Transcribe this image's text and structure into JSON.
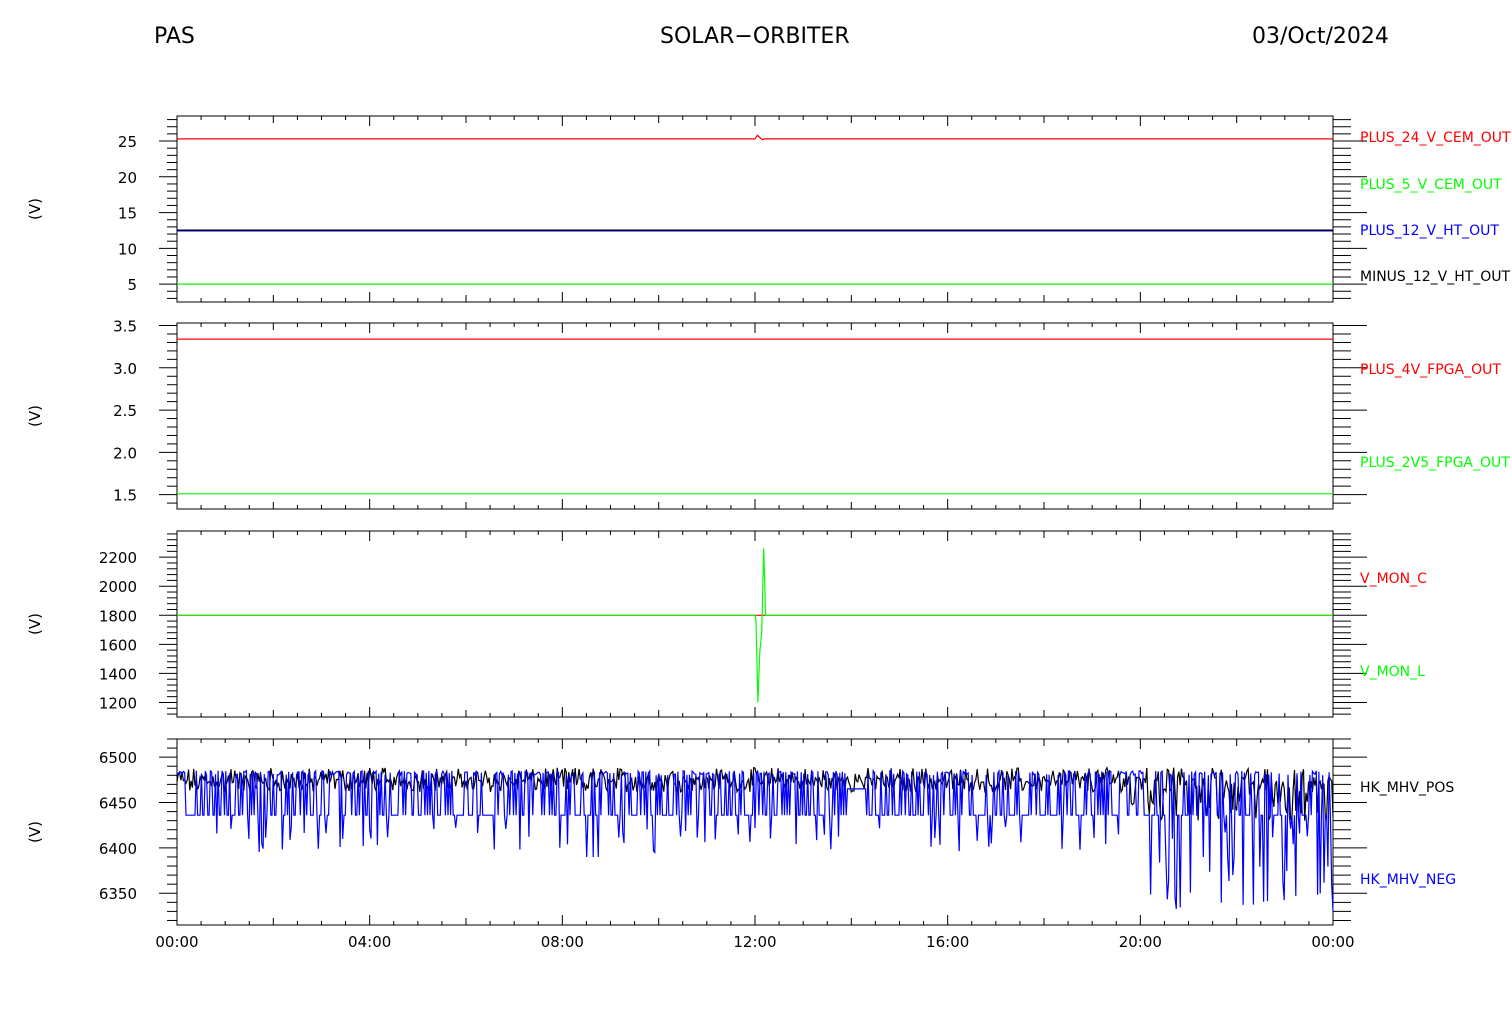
{
  "header": {
    "left": "PAS",
    "center": "SOLAR−ORBITER",
    "right": "03/Oct/2024"
  },
  "colors": {
    "red": "#ff0000",
    "green": "#00ff00",
    "blue": "#0000ff",
    "navy": "#00007f",
    "black": "#000000"
  },
  "chart_data": [
    {
      "type": "line",
      "ylabel": "(V)",
      "ylim": [
        2.5,
        28.5
      ],
      "yticks": [
        5,
        10,
        15,
        20,
        25
      ],
      "yticklabels": [
        "5",
        "10",
        "15",
        "20",
        "25"
      ],
      "xlim": [
        0,
        24
      ],
      "legend": "right",
      "series": [
        {
          "name": "PLUS_24_V_CEM_OUT",
          "color": "#ff0000",
          "x": [
            0,
            12.0,
            12.05,
            12.1,
            12.15,
            12.2,
            24
          ],
          "y": [
            25.3,
            25.3,
            25.8,
            25.5,
            25.2,
            25.3,
            25.3
          ]
        },
        {
          "name": "PLUS_5_V_CEM_OUT",
          "color": "#00ff00",
          "x": [
            0,
            24
          ],
          "y": [
            5.0,
            5.0
          ]
        },
        {
          "name": "PLUS_12_V_HT_OUT",
          "color": "#0000ff",
          "x": [
            0,
            24
          ],
          "y": [
            12.5,
            12.5
          ]
        },
        {
          "name": "MINUS_12_V_HT_OUT",
          "color": "#000000",
          "x": [
            0,
            24
          ],
          "y": [
            12.55,
            12.55
          ]
        }
      ]
    },
    {
      "type": "line",
      "ylabel": "(V)",
      "ylim": [
        1.33,
        3.53
      ],
      "yticks": [
        1.5,
        2.0,
        2.5,
        3.0,
        3.5
      ],
      "yticklabels": [
        "1.5",
        "2.0",
        "2.5",
        "3.0",
        "3.5"
      ],
      "xlim": [
        0,
        24
      ],
      "legend": "right",
      "series": [
        {
          "name": "PLUS_4V_FPGA_OUT",
          "color": "#ff0000",
          "x": [
            0,
            24
          ],
          "y": [
            3.34,
            3.34
          ]
        },
        {
          "name": "PLUS_2V5_FPGA_OUT",
          "color": "#00ff00",
          "x": [
            0,
            24
          ],
          "y": [
            1.51,
            1.51
          ]
        }
      ]
    },
    {
      "type": "line",
      "ylabel": "(V)",
      "ylim": [
        1100,
        2380
      ],
      "yticks": [
        1200,
        1400,
        1600,
        1800,
        2000,
        2200
      ],
      "yticklabels": [
        "1200",
        "1400",
        "1600",
        "1800",
        "2000",
        "2200"
      ],
      "xlim": [
        0,
        24
      ],
      "legend": "right",
      "series": [
        {
          "name": "V_MON_C",
          "color": "#ff0000",
          "x": [
            0,
            24
          ],
          "y": [
            1800,
            1800
          ]
        },
        {
          "name": "V_MON_L",
          "color": "#00ff00",
          "x": [
            0,
            12.0,
            12.02,
            12.06,
            12.1,
            12.14,
            12.18,
            12.22,
            12.25,
            24
          ],
          "y": [
            1800,
            1800,
            1760,
            1200,
            1550,
            1680,
            2260,
            1800,
            1800,
            1800
          ]
        }
      ]
    },
    {
      "type": "line",
      "ylabel": "(V)",
      "ylim": [
        6315,
        6520
      ],
      "yticks": [
        6350,
        6400,
        6450,
        6500
      ],
      "yticklabels": [
        "6350",
        "6400",
        "6450",
        "6500"
      ],
      "xlim": [
        0,
        24
      ],
      "xticks": [
        0,
        4,
        8,
        12,
        16,
        20,
        24
      ],
      "xticklabels": [
        "00:00",
        "04:00",
        "08:00",
        "12:00",
        "16:00",
        "20:00",
        "00:00"
      ],
      "legend": "right",
      "series": [
        {
          "name": "HK_MHV_POS",
          "color": "#000000",
          "base": 6470,
          "noise": 12
        },
        {
          "name": "HK_MHV_NEG",
          "color": "#0000ff",
          "base": 6440,
          "noise": 45
        }
      ]
    }
  ]
}
